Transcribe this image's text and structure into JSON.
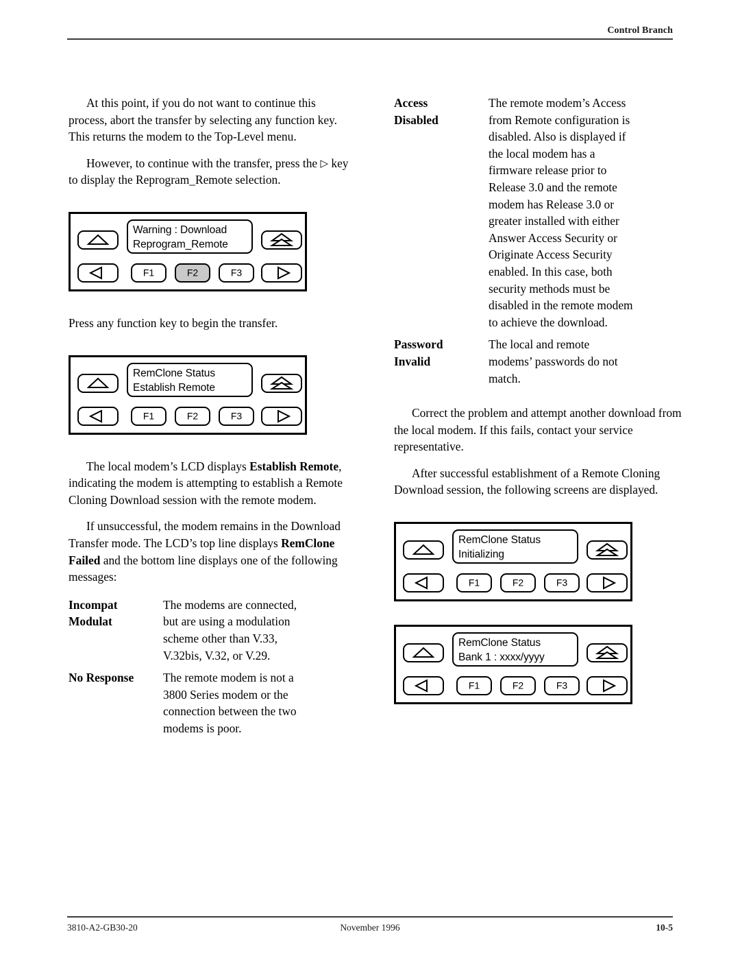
{
  "header": {
    "title": "Control Branch"
  },
  "footer": {
    "doc_number": "3810-A2-GB30-20",
    "date": "November 1996",
    "page_number": "10-5"
  },
  "left_column": {
    "paragraph_1": "At this point, if you do not want to continue this process, abort the transfer by selecting any function key. This returns the modem to the Top-Level menu.",
    "paragraph_2_part_1": "However, to continue with the transfer, press the ",
    "paragraph_2_arrow": "▷",
    "paragraph_2_part_2": " key to display the Reprogram_Remote selection.",
    "figure_1": {
      "lcd_line_1": "Warning : Download",
      "lcd_line_2": "Reprogram_Remote",
      "keys": {
        "f1": "F1",
        "f2": "F2",
        "f3": "F3"
      },
      "f2_highlighted": true
    },
    "paragraph_3": "Press any function key to begin the transfer.",
    "figure_2": {
      "lcd_line_1": "RemClone Status",
      "lcd_line_2": "Establish Remote",
      "keys": {
        "f1": "F1",
        "f2": "F2",
        "f3": "F3"
      },
      "f2_highlighted": false
    },
    "paragraph_4_part_1": "The local modem’s LCD displays ",
    "paragraph_4_bold": "Establish Remote",
    "paragraph_4_part_2": ", indicating the modem is attempting to establish a Remote Cloning Download session with the remote modem.",
    "paragraph_5_part_1": "If unsuccessful, the modem remains in the Download Transfer mode. The LCD’s top line displays ",
    "paragraph_5_bold": "RemClone Failed",
    "paragraph_5_part_2": " and the bottom line displays one of the following messages:",
    "messages": [
      {
        "term_lines": [
          "Incompat",
          "Modulat"
        ],
        "desc_lines": [
          "The modems are connected,",
          "but are using a modulation",
          "scheme other than V.33,",
          "V.32bis, V.32, or V.29."
        ]
      },
      {
        "term_lines": [
          "No Response"
        ],
        "desc_lines": [
          "The remote modem is not a",
          "3800 Series modem or the",
          "connection between the two",
          "modems is poor."
        ]
      }
    ]
  },
  "right_column": {
    "messages": [
      {
        "term_lines": [
          "Access",
          "Disabled"
        ],
        "desc_lines": [
          "The remote modem’s Access",
          "from Remote configuration is",
          "disabled. Also is displayed if",
          "the local modem has a",
          "firmware release prior to",
          "Release 3.0 and the remote",
          "modem has Release 3.0 or",
          "greater installed with either",
          "Answer Access Security or",
          "Originate Access Security",
          "enabled. In this case, both",
          "security methods must be",
          "disabled in the remote modem",
          "to achieve the download."
        ]
      },
      {
        "term_lines": [
          "Password",
          "Invalid"
        ],
        "desc_lines": [
          "The local and remote",
          "modems’ passwords do not",
          "match."
        ]
      }
    ],
    "paragraph_1": "Correct the problem and attempt another download from the local modem. If this fails, contact your service representative.",
    "paragraph_2": "After successful establishment of a Remote Cloning Download session, the following screens are displayed.",
    "figure_3": {
      "lcd_line_1": "RemClone Status",
      "lcd_line_2": "Initializing",
      "keys": {
        "f1": "F1",
        "f2": "F2",
        "f3": "F3"
      },
      "f2_highlighted": false
    },
    "figure_4": {
      "lcd_line_1": "RemClone Status",
      "lcd_line_2": "Bank 1 : xxxx/yyyy",
      "keys": {
        "f1": "F1",
        "f2": "F2",
        "f3": "F3"
      },
      "f2_highlighted": false
    }
  },
  "icons": {
    "up_arrow": "up-triangle-icon",
    "left_arrow": "left-triangle-icon",
    "right_arrow": "right-triangle-icon",
    "eject": "double-triangle-eject-icon"
  },
  "colors": {
    "text": "#000000",
    "rule": "#3b3b3b",
    "key_highlight": "#c9c9c9",
    "panel_border": "#000000"
  }
}
